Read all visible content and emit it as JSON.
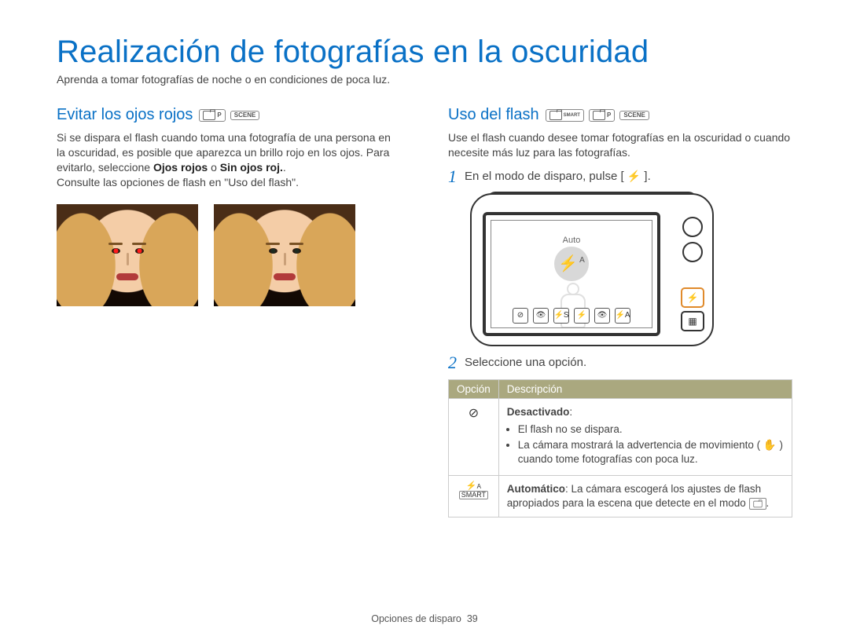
{
  "title": "Realización de fotografías en la oscuridad",
  "lead": "Aprenda a tomar fotografías de noche o en condiciones de poca luz.",
  "left": {
    "heading": "Evitar los ojos rojos",
    "badges": [
      "P",
      "SCENE"
    ],
    "para_before": "Si se dispara el flash cuando toma una fotografía de una persona en la oscuridad, es posible que aparezca un brillo rojo en los ojos. Para evitarlo, seleccione ",
    "bold1": "Ojos rojos",
    "mid": " o ",
    "bold2": "Sin ojos roj.",
    "after": ".",
    "para2": "Consulte las opciones de flash en \"Uso del flash\"."
  },
  "right": {
    "heading": "Uso del flash",
    "badges": [
      "SMART",
      "P",
      "SCENE"
    ],
    "intro": "Use el flash cuando desee tomar fotografías en la oscuridad o cuando necesite más luz para las fotografías.",
    "step1_num": "1",
    "step1_text_a": "En el modo de disparo, pulse [ ",
    "step1_text_b": " ].",
    "camera": {
      "auto_label": "Auto",
      "bigflash_sup": "A",
      "iconrow": [
        "⊘",
        "👁",
        "⚡S",
        "⚡",
        "👁",
        "⚡A"
      ]
    },
    "step2_num": "2",
    "step2_text": "Seleccione una opción.",
    "table": {
      "th1": "Opción",
      "th2": "Descripción",
      "rows": [
        {
          "icon": "⊘",
          "title": "Desactivado",
          "title_suffix": ":",
          "bullets": [
            "El flash no se dispara.",
            "La cámara mostrará la advertencia de movimiento ( ✋ ) cuando tome fotografías con poca luz."
          ]
        },
        {
          "icon": "⚡A",
          "plain_before": "",
          "title": "Automático",
          "plain": ": La cámara escogerá los ajustes de flash apropiados para la escena que detecte en el modo ",
          "trail_badge": "SMART",
          "trail_dot": "."
        }
      ]
    }
  },
  "footer": {
    "section": "Opciones de disparo",
    "page": "39"
  }
}
